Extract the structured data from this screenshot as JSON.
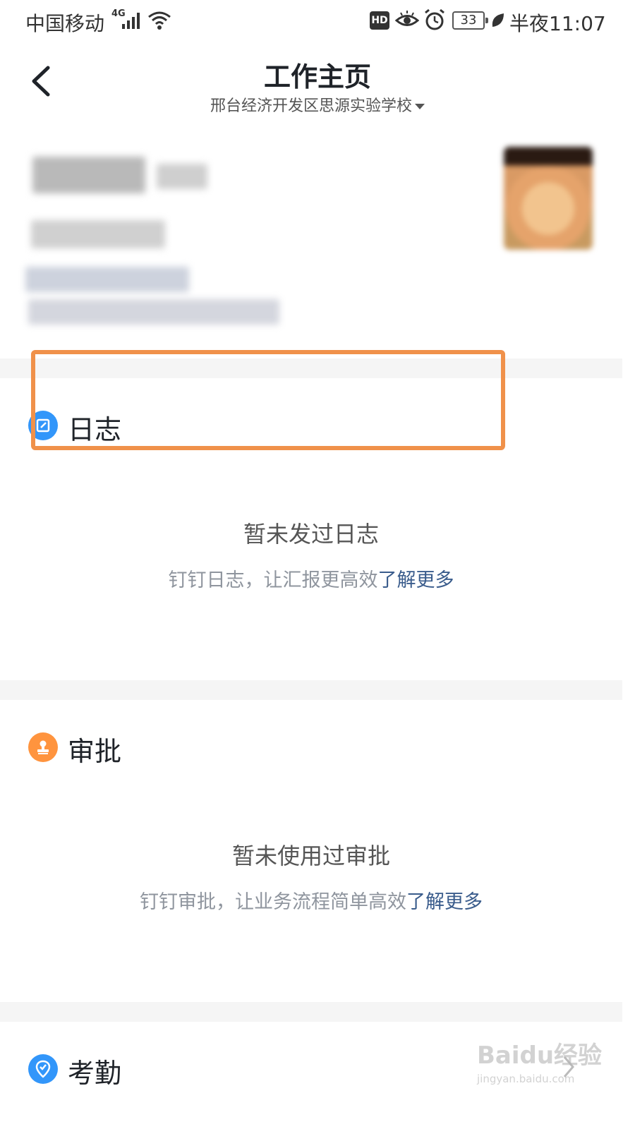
{
  "status_bar": {
    "carrier": "中国移动",
    "network_type": "4G",
    "hd_badge": "HD",
    "battery_level": "33",
    "time": "半夜11:07"
  },
  "header": {
    "title": "工作主页",
    "organization": "邢台经济开发区思源实验学校"
  },
  "sections": {
    "log": {
      "title": "日志",
      "empty_title": "暂未发过日志",
      "empty_desc": "钉钉日志，让汇报更高效",
      "learn_more": "了解更多",
      "icon": "edit-icon",
      "color": "#3296fa"
    },
    "approval": {
      "title": "审批",
      "empty_title": "暂未使用过审批",
      "empty_desc": "钉钉审批，让业务流程简单高效",
      "learn_more": "了解更多",
      "icon": "stamp-icon",
      "color": "#ff943e"
    },
    "attendance": {
      "title": "考勤",
      "icon": "location-check-icon",
      "color": "#3296fa"
    }
  },
  "colors": {
    "highlight": "#f0914a",
    "link": "#3a5c8c"
  },
  "watermark": {
    "main": "Baidu经验",
    "sub": "jingyan.baidu.com"
  }
}
